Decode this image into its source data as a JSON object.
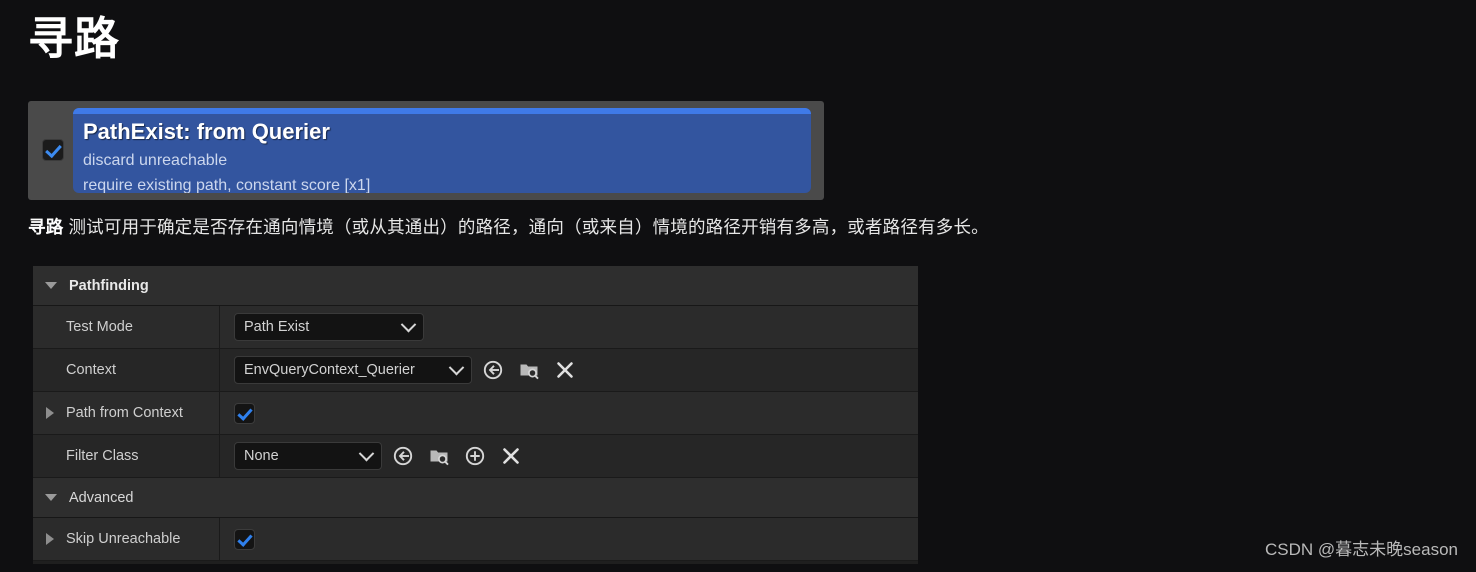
{
  "page": {
    "title": "寻路",
    "caption_lead": "寻路",
    "caption_rest": " 测试可用于确定是否存在通向情境（或从其通出）的路径，通向（或来自）情境的路径开销有多高，或者路径有多长。"
  },
  "node": {
    "enabled_checkbox": true,
    "title": "PathExist: from Querier",
    "subtitle_1": "discard unreachable",
    "subtitle_2": "require existing path, constant score [x1]",
    "header_color": "#3f7ae8",
    "body_color": "#33559f"
  },
  "details": {
    "sections": [
      {
        "label": "Pathfinding",
        "expanded": true
      },
      {
        "label": "Advanced",
        "expanded": true
      }
    ],
    "rows": {
      "test_mode": {
        "label": "Test Mode",
        "value": "Path Exist"
      },
      "context": {
        "label": "Context",
        "value": "EnvQueryContext_Querier"
      },
      "path_from_context": {
        "label": "Path from Context",
        "checked": true
      },
      "filter_class": {
        "label": "Filter Class",
        "value": "None"
      },
      "skip_unreachable": {
        "label": "Skip Unreachable",
        "checked": true
      }
    },
    "icons": {
      "use_selected": "use-selected-asset-icon",
      "browse": "browse-asset-icon",
      "add": "add-icon",
      "clear": "clear-icon"
    }
  },
  "watermark": "CSDN @暮志未晚season"
}
